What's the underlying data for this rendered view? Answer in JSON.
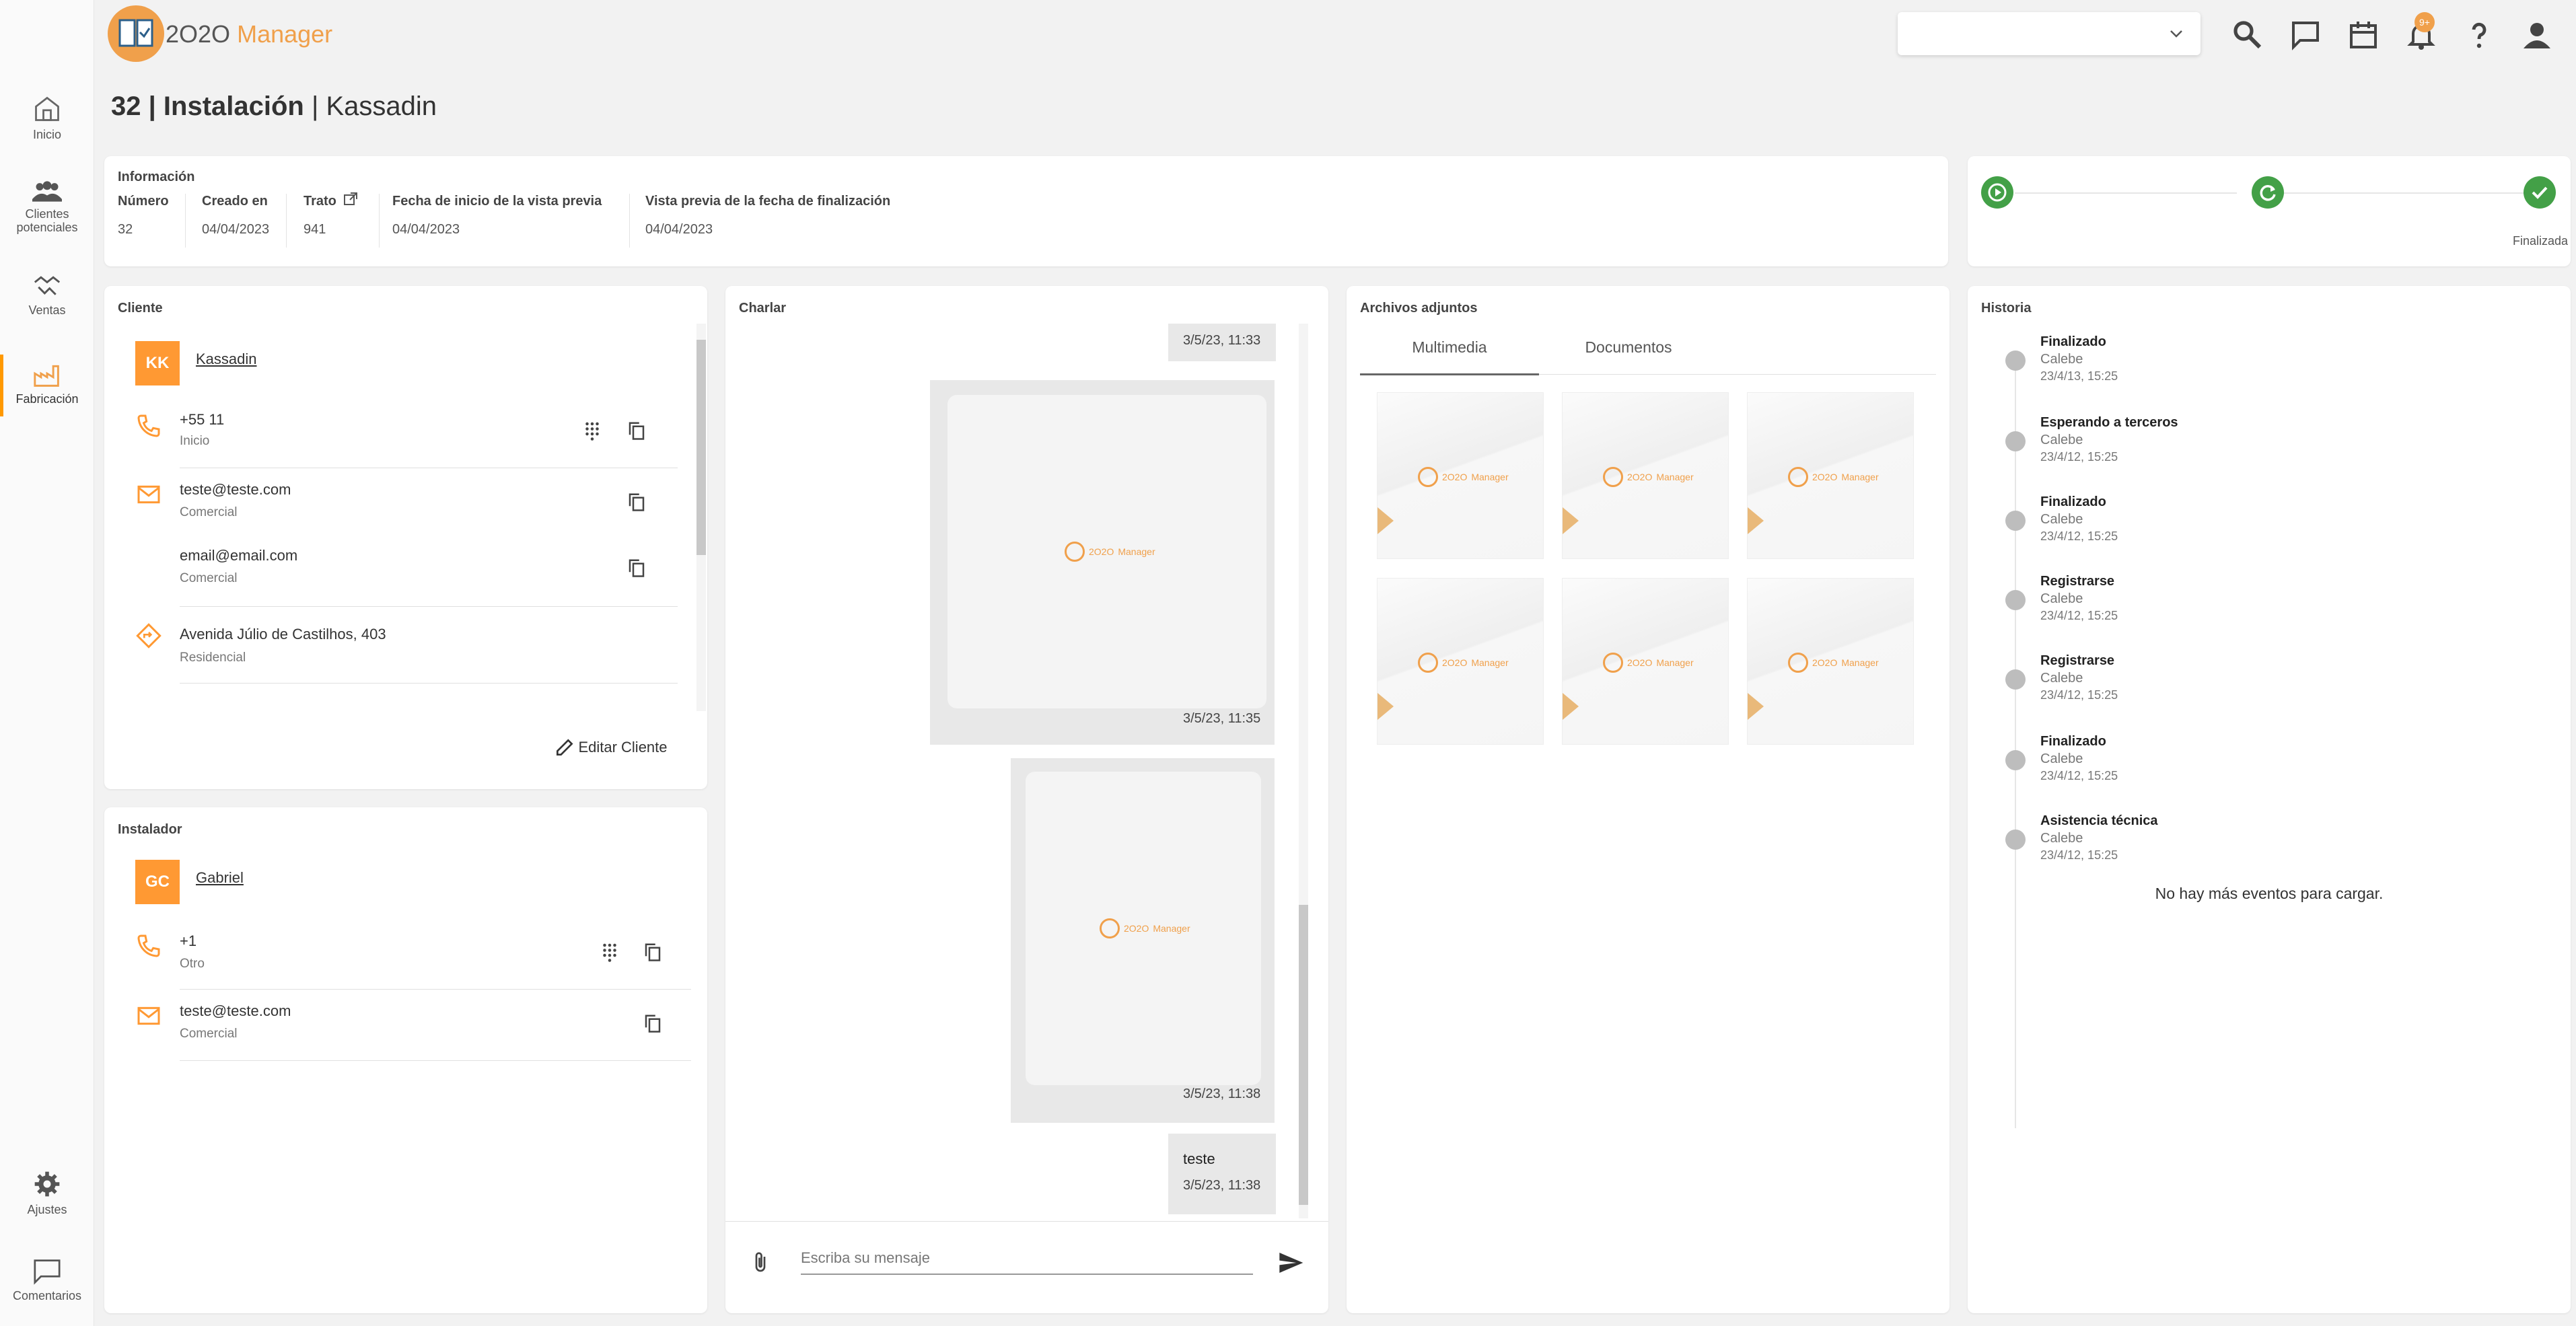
{
  "app": {
    "name_pre": "2",
    "name_mid": "O2O",
    "name_word": "Manager"
  },
  "nav": [
    {
      "label": "Inicio",
      "icon": "home-icon"
    },
    {
      "label": "Clientes potenciales",
      "icon": "users-icon"
    },
    {
      "label": "Ventas",
      "icon": "handshake-icon"
    },
    {
      "label": "Fabricación",
      "icon": "factory-icon"
    },
    {
      "label": "Ajustes",
      "icon": "gear-icon"
    },
    {
      "label": "Comentarios",
      "icon": "comment-icon"
    }
  ],
  "header": {
    "badge": "9+",
    "select_value": ""
  },
  "title": {
    "bold": "32 | Instalación",
    "rest": " | Kassadin"
  },
  "info": {
    "title": "Información",
    "fields": [
      {
        "label": "Número",
        "value": "32"
      },
      {
        "label": "Creado en",
        "value": "04/04/2023"
      },
      {
        "label": "Trato",
        "value": "941"
      },
      {
        "label": "Fecha de inicio de la vista previa",
        "value": "04/04/2023"
      },
      {
        "label": "Vista previa de la fecha de finalización",
        "value": "04/04/2023"
      }
    ]
  },
  "progress": {
    "final_label": "Finalizada"
  },
  "client": {
    "title": "Cliente",
    "initials": "KK",
    "name": "Kassadin",
    "phone": "+55 11",
    "phone_type": "Inicio",
    "email1": "teste@teste.com",
    "email1_type": "Comercial",
    "email2": "email@email.com",
    "email2_type": "Comercial",
    "address": "Avenida Júlio de Castilhos, 403",
    "address_type": "Residencial",
    "edit_label": "Editar Cliente"
  },
  "installer": {
    "title": "Instalador",
    "initials": "GC",
    "name": "Gabriel",
    "phone": "+1",
    "phone_type": "Otro",
    "email": "teste@teste.com",
    "email_type": "Comercial"
  },
  "chat": {
    "title": "Charlar",
    "messages": [
      {
        "time": "3/5/23, 11:33"
      },
      {
        "time": "3/5/23, 11:35"
      },
      {
        "time": "3/5/23, 11:38"
      },
      {
        "text": "teste",
        "time": "3/5/23, 11:38"
      }
    ],
    "placeholder": "Escriba su mensaje"
  },
  "attachments": {
    "title": "Archivos adjuntos",
    "tabs": [
      "Multimedia",
      "Documentos"
    ],
    "thumb_logo_mid": "2O2O",
    "thumb_logo_word": "Manager"
  },
  "history": {
    "title": "Historia",
    "events": [
      {
        "title": "Finalizado",
        "user": "Calebe",
        "date": "23/4/13, 15:25"
      },
      {
        "title": "Esperando a terceros",
        "user": "Calebe",
        "date": "23/4/12, 15:25"
      },
      {
        "title": "Finalizado",
        "user": "Calebe",
        "date": "23/4/12, 15:25"
      },
      {
        "title": "Registrarse",
        "user": "Calebe",
        "date": "23/4/12, 15:25"
      },
      {
        "title": "Registrarse",
        "user": "Calebe",
        "date": "23/4/12, 15:25"
      },
      {
        "title": "Finalizado",
        "user": "Calebe",
        "date": "23/4/12, 15:25"
      },
      {
        "title": "Asistencia técnica",
        "user": "Calebe",
        "date": "23/4/12, 15:25"
      }
    ],
    "end_text": "No hay más eventos para cargar."
  },
  "colors": {
    "accent": "#ff9933",
    "success": "#43a047"
  }
}
